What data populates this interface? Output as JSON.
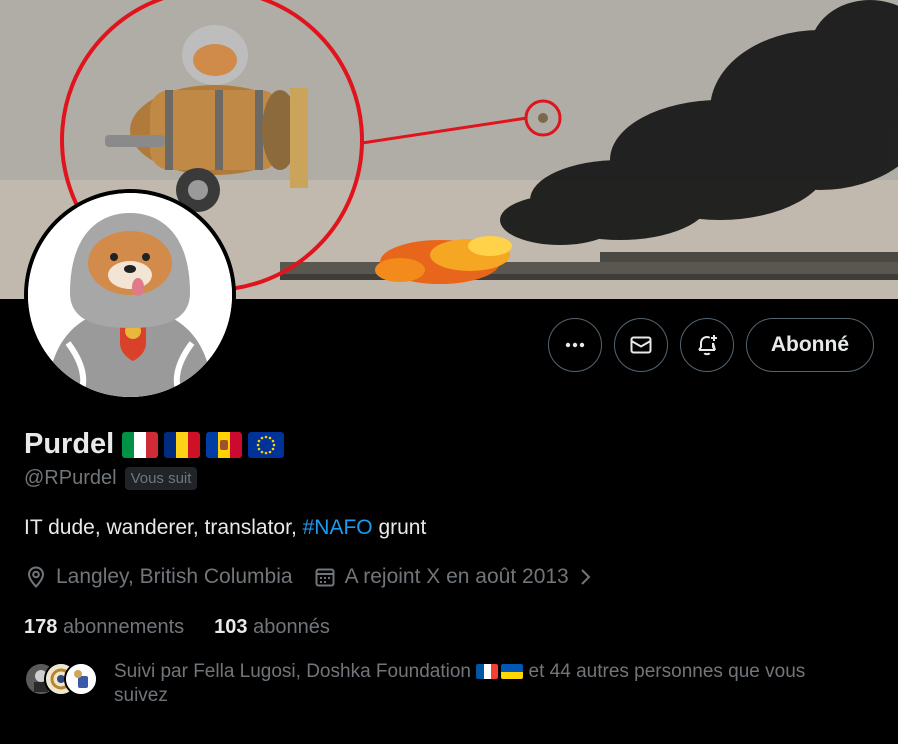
{
  "profile": {
    "display_name": "Purdel",
    "handle": "@RPurdel",
    "follows_you_badge": "Vous suit",
    "bio_prefix": "IT dude, wanderer, translator, ",
    "bio_hashtag": "#NAFO",
    "bio_suffix": " grunt",
    "location": "Langley, British Columbia",
    "joined": "A rejoint X en août 2013",
    "following_count": "178",
    "following_label": "abonnements",
    "followers_count": "103",
    "followers_label": "abonnés",
    "name_flags": [
      "italy-flag",
      "romania-flag",
      "moldova-flag",
      "eu-flag"
    ]
  },
  "actions": {
    "more_icon": "more-icon",
    "message_icon": "mail-icon",
    "notify_icon": "bell-plus-icon",
    "follow_label": "Abonné"
  },
  "followed_by": {
    "text_prefix": "Suivi par Fella Lugosi, Doshka Foundation",
    "text_suffix": " et 44 autres personnes que vous suivez",
    "inline_flags": [
      "france-flag",
      "ukraine-flag"
    ]
  },
  "colors": {
    "background": "#000000",
    "text_primary": "#e7e9ea",
    "text_secondary": "#71767b",
    "accent": "#1d9bf0",
    "border": "#536471"
  }
}
